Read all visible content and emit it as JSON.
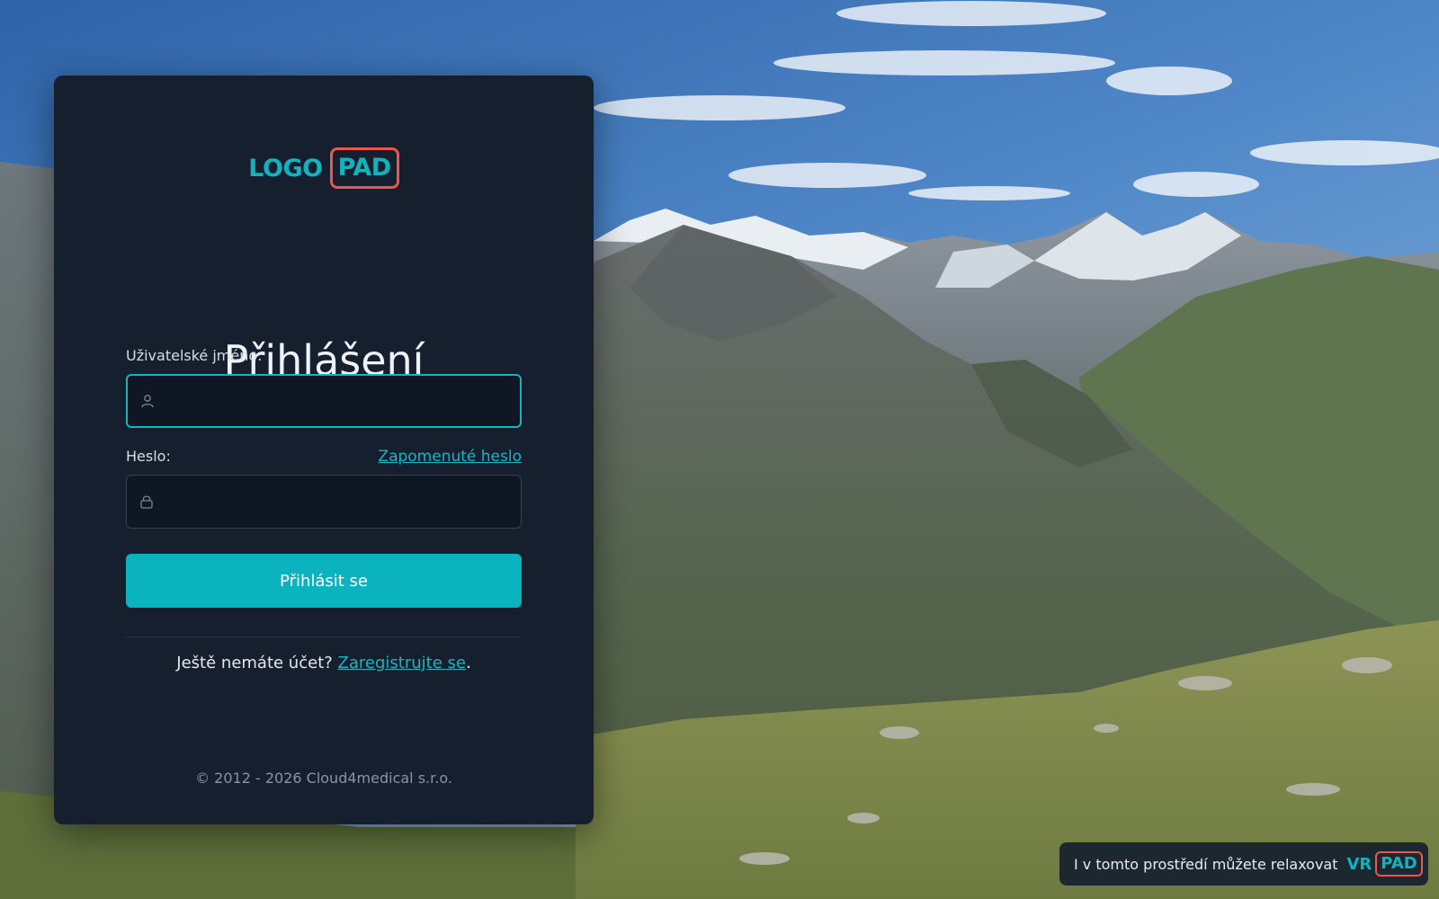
{
  "logo": {
    "left_text": "LOGO",
    "right_text": "PAD"
  },
  "login": {
    "title": "Přihlášení",
    "username_label": "Uživatelské jméno:",
    "username_value": "",
    "password_label": "Heslo:",
    "password_value": "",
    "forgot_password_link": "Zapomenuté heslo",
    "submit_label": "Přihlásit se",
    "register_prompt": "Ještě nemáte účet?",
    "register_link": "Zaregistrujte se",
    "register_suffix": "."
  },
  "footer": {
    "copyright": "© 2012 - 2026 Cloud4medical s.r.o."
  },
  "vr_badge": {
    "text": "I v tomto prostředí můžete relaxovat",
    "logo_left": "VR",
    "logo_right": "PAD"
  },
  "icons": {
    "username": "user-icon",
    "password": "lock-icon"
  },
  "colors": {
    "accent": "#0bb3be",
    "logo_frame": "#e9574f",
    "card_background": "#161f2e",
    "input_background": "#0f1624"
  }
}
